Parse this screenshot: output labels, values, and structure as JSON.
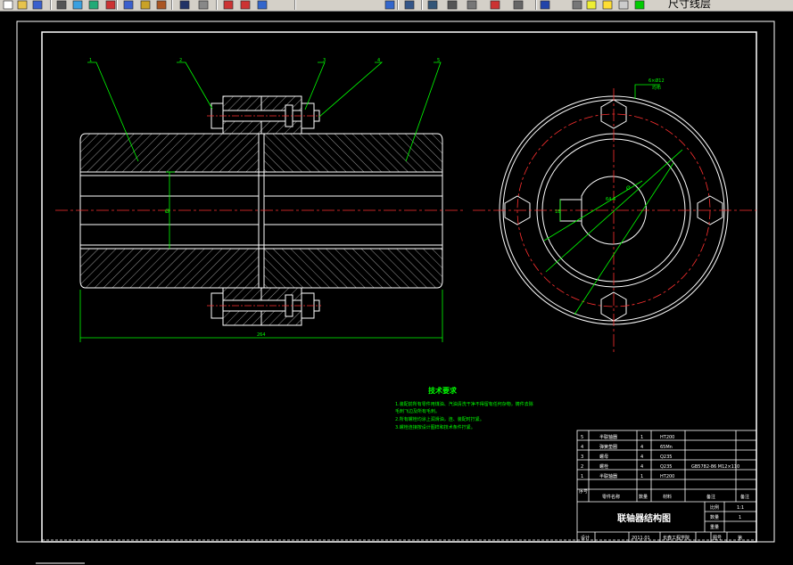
{
  "toolbar": {
    "layer_name": "尺寸线层",
    "icons": [
      "new-icon",
      "open-icon",
      "save-icon",
      "print-icon",
      "preview-icon",
      "publish-icon",
      "cut-icon",
      "copy-icon",
      "paste-icon",
      "matchprop-icon",
      "undo-icon",
      "redo-icon",
      "pan-icon",
      "zoom-realtime-icon",
      "zoom-window-icon",
      "zoom-previous-icon",
      "properties-icon",
      "designcenter-icon",
      "toolpalette-icon",
      "sheetset-icon",
      "markup-icon",
      "calculator-icon",
      "help-icon",
      "layer-manager-icon",
      "layer-on-icon",
      "layer-freeze-icon",
      "layer-lock-icon",
      "layer-color-icon"
    ]
  },
  "drawing": {
    "balloons": [
      "1",
      "2",
      "3",
      "4",
      "5"
    ],
    "chamfer_callout": [
      "6×Ø12",
      "均布"
    ],
    "overall_length_dim": "264",
    "shaft_diameter_dim": "Ø",
    "keyway_dims": [
      "64.4",
      "18",
      "Ø"
    ],
    "notes_title": "技术要求",
    "notes": [
      "1.装配前所有零件用煤油、汽油清洗干净不得留有任何杂物，铸件去除",
      "毛刺飞边及所有毛刺。",
      "2.所有螺栓均涂上润滑油，连、装配时拧紧。",
      "3.螺栓连接按设计图样和技术条件拧紧。"
    ],
    "title_block": {
      "drawing_title": "联轴器结构图",
      "parts": [
        {
          "no": "5",
          "name": "半联轴器",
          "qty": "1",
          "material": "HT200",
          "note": ""
        },
        {
          "no": "4",
          "name": "弹簧垫圈",
          "qty": "4",
          "material": "65Mn",
          "note": ""
        },
        {
          "no": "3",
          "name": "螺母",
          "qty": "4",
          "material": "Q235",
          "note": ""
        },
        {
          "no": "2",
          "name": "螺栓",
          "qty": "4",
          "material": "Q235",
          "note": "GB5782-86 M12×110"
        },
        {
          "no": "1",
          "name": "半联轴器",
          "qty": "1",
          "material": "HT200",
          "note": ""
        }
      ],
      "header": {
        "no": "序号",
        "name": "零件名称",
        "qty": "数量",
        "material": "材料",
        "note": "备注",
        "remark": "备注"
      },
      "scale_label": "比例",
      "scale": "1:1",
      "qty_label": "数量",
      "qty": "1",
      "design_label": "设计",
      "design_date": "2011.01",
      "school": "长春工程学院",
      "check_label": "审核",
      "weight_label": "重量",
      "drawno_label": "图号",
      "sheet": "第"
    }
  }
}
